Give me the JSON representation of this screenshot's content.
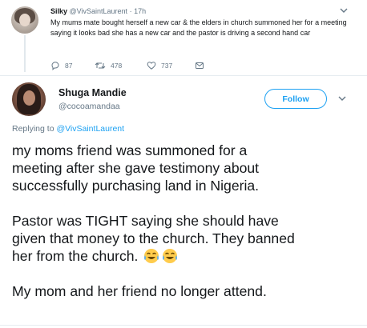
{
  "parent_tweet": {
    "name": "Silky",
    "handle": "@VivSaintLaurent",
    "time": "17h",
    "text": "My mums mate bought herself a new car & the elders in church summoned her for a meeting saying it looks bad she has a new car and the pastor is driving a second hand car",
    "replies": "87",
    "retweets": "478",
    "likes": "737"
  },
  "main_tweet": {
    "name": "Shuga Mandie",
    "handle": "@cocoamandaa",
    "follow_label": "Follow",
    "replying_prefix": "Replying to",
    "replying_to": "@VivSaintLaurent",
    "lines": [
      "my moms friend was summoned for a",
      "meeting after she gave testimony about",
      "successfully purchasing land in Nigeria.",
      "",
      "Pastor was TIGHT saying she should have",
      "given that money to the church. They banned",
      "her from the church.",
      "",
      "My mom and her friend no longer attend."
    ]
  },
  "icons": {
    "reply": "reply-icon",
    "retweet": "retweet-icon",
    "like": "heart-icon",
    "message": "envelope-icon",
    "caret": "chevron-down-icon",
    "emoji": "face-with-tears-of-joy-icon"
  },
  "colors": {
    "accent": "#1da1f2",
    "text": "#14171a",
    "muted": "#657786",
    "divider": "#e6ecf0"
  }
}
